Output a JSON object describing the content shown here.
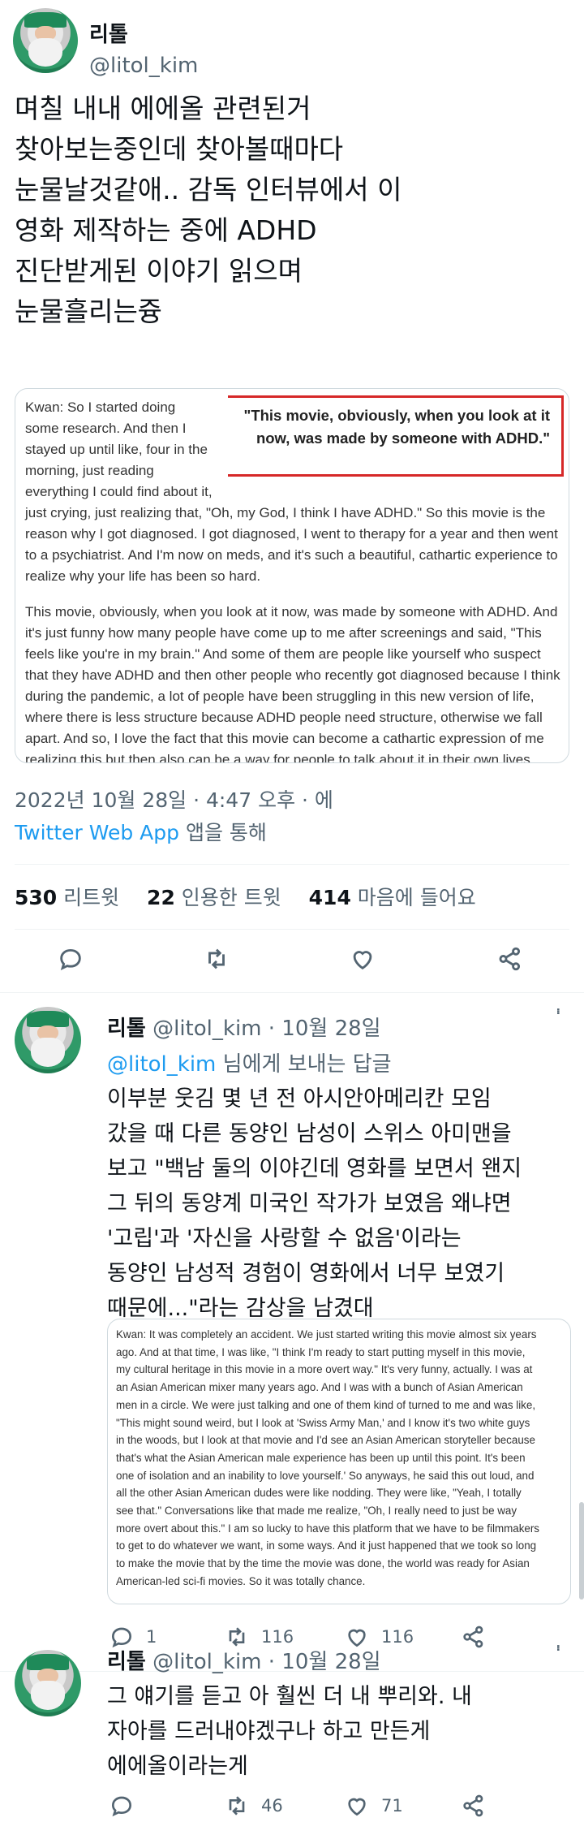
{
  "tweet": {
    "author_name": "리톨",
    "author_handle": "@litol_kim",
    "text_lines": [
      "며칠 내내 에에올 관련된거",
      "찾아보는중인데 찾아볼때마다",
      "눈물날것같애.. 감독 인터뷰에서 이",
      "영화 제작하는 중에 ADHD",
      "진단받게된 이야기 읽으며",
      "눈물흘리는즁"
    ],
    "image1": {
      "pullquote": "\"This movie, obviously, when you look at it now, was made by someone with ADHD.\"",
      "para1_lines_left": [
        "Kwan: So I started doing",
        "some research. And then I",
        "stayed up until like, four in the",
        "morning, just reading",
        "everything I could find about it,"
      ],
      "para1_lines_full": [
        "just crying, just realizing that, \"Oh, my God, I think I have ADHD.\" So this movie is the",
        "reason why I got diagnosed. I got diagnosed, I went to therapy for a year and then went",
        "to a psychiatrist. And I'm now on meds, and it's such a beautiful, cathartic experience to",
        "realize why your life has been so hard."
      ],
      "para2_lines": [
        "This movie, obviously, when you look at it now, was made by someone with ADHD. And",
        "it's just funny how many people have come up to me after screenings and said, \"This",
        "feels like you're in my brain.\" And some of them are people like yourself who suspect",
        "that they have ADHD and then other people who recently got diagnosed because I think",
        "during the pandemic, a lot of people have been struggling in this new version of life,",
        "where there is less structure because ADHD people need structure, otherwise we fall",
        "apart. And so, I love the fact that this movie can become a cathartic expression of me",
        "realizing this but then also can be a way for people to talk about it in their own lives."
      ]
    },
    "timestamp": "2022년 10월 28일 · 4:47 오후 · 에",
    "source_link": "Twitter Web App",
    "source_suffix": " 앱을 통해",
    "stats": {
      "retweets_num": "530",
      "retweets_lbl": " 리트윗",
      "quotes_num": "22",
      "quotes_lbl": " 인용한 트윗",
      "likes_num": "414",
      "likes_lbl": " 마음에 들어요"
    }
  },
  "reply1": {
    "author_name": "리톨",
    "author_handle": "@litol_kim",
    "date": " · 10월 28일",
    "replying_to_handle": "@litol_kim",
    "replying_to_suffix": " 님에게 보내는 답글",
    "text_lines": [
      "이부분 웃김 몇 년 전 아시안아메리칸 모임",
      "갔을 때 다른 동양인 남성이 스위스 아미맨을",
      "보고 \"백남 둘의 이야긴데 영화를 보면서 왠지",
      "그 뒤의 동양계 미국인 작가가 보였음 왜냐면",
      "'고립'과 '자신을 사랑할 수 없음'이라는",
      "동양인 남성적 경험이 영화에서 너무 보였기",
      "때문에...\"라는 감상을 남겼대"
    ],
    "image_lines": [
      "Kwan: It was completely an accident. We just started writing this movie almost six years",
      "ago. And at that time, I was like, \"I think I'm ready to start putting myself in this movie,",
      "my cultural heritage in this movie in a more overt way.\" It's very funny, actually. I was at",
      "an Asian American mixer many years ago. And I was with a bunch of Asian American",
      "men in a circle. We were just talking and one of them kind of turned to me and was like,",
      "\"This might sound weird, but I look at 'Swiss Army Man,' and I know it's two white guys",
      "in the woods, but I look at that movie and I'd see an Asian American storyteller because",
      "that's what the Asian American male experience has been up until this point. It's been",
      "one of isolation and an inability to love yourself.' So anyways, he said this out loud, and",
      "all the other Asian American dudes were like nodding. They were like, \"Yeah, I totally",
      "see that.\" Conversations like that made me realize, \"Oh, I really need to just be way",
      "more overt about this.\" I am so lucky to have this platform that we have to be filmmakers",
      "to get to do whatever we want, in some ways. And it just happened that we took so long",
      "to make the movie that by the time the movie was done, the world was ready for Asian",
      "American-led sci-fi movies. So it was totally chance."
    ],
    "actions": {
      "replies": "1",
      "retweets": "116",
      "likes": "116"
    }
  },
  "reply2": {
    "author_name": "리톨",
    "author_handle": "@litol_kim",
    "date": " · 10월 28일",
    "text_lines": [
      "그 얘기를 듣고 아 훨씬 더 내 뿌리와. 내",
      "자아를 드러내야겠구나 하고 만든게",
      "에에올이라는게"
    ],
    "actions": {
      "retweets": "46",
      "likes": "71"
    }
  },
  "colors": {
    "accent": "#1d9bf0",
    "muted": "#536471",
    "highlight_box": "#d62828"
  },
  "icons": [
    "reply-icon",
    "retweet-icon",
    "like-icon",
    "share-icon",
    "more-icon"
  ]
}
